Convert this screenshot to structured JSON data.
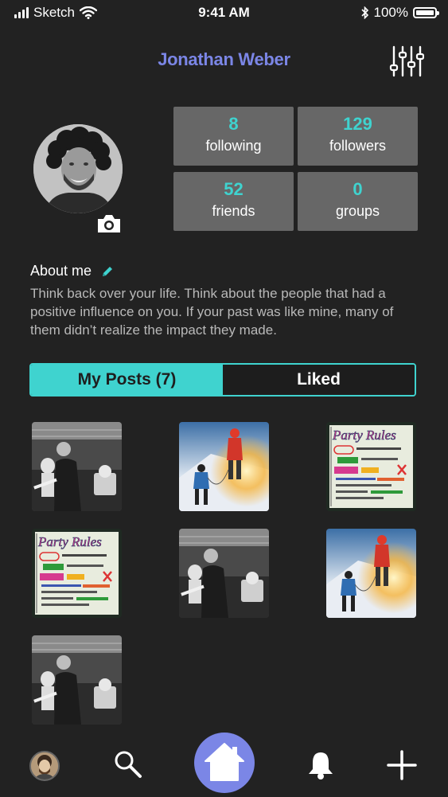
{
  "status_bar": {
    "carrier": "Sketch",
    "time": "9:41 AM",
    "battery": "100%"
  },
  "profile": {
    "name": "Jonathan Weber",
    "stats": [
      {
        "value": "8",
        "label": "following"
      },
      {
        "value": "129",
        "label": "followers"
      },
      {
        "value": "52",
        "label": "friends"
      },
      {
        "value": "0",
        "label": "groups"
      }
    ]
  },
  "about": {
    "title": "About me",
    "text": "Think back over your life. Think about the people that had a positive influence on you. If your past was like mine, many of them didn’t realize the impact they made."
  },
  "tabs": [
    {
      "label": "My Posts (7)",
      "active": true
    },
    {
      "label": "Liked",
      "active": false
    }
  ],
  "posts": [
    {
      "kind": "band-photo"
    },
    {
      "kind": "climbers-photo"
    },
    {
      "kind": "party-rules-sign"
    },
    {
      "kind": "party-rules-sign"
    },
    {
      "kind": "band-photo"
    },
    {
      "kind": "climbers-photo"
    },
    {
      "kind": "band-photo"
    }
  ],
  "party_rules_text": "Party Rules",
  "colors": {
    "background": "#222222",
    "accent_teal": "#3fd3cf",
    "accent_purple": "#7b86e6",
    "stat_tile": "#676767"
  },
  "nav": [
    {
      "icon": "profile-avatar"
    },
    {
      "icon": "search-icon"
    },
    {
      "icon": "home-icon"
    },
    {
      "icon": "bell-icon"
    },
    {
      "icon": "plus-icon"
    }
  ]
}
